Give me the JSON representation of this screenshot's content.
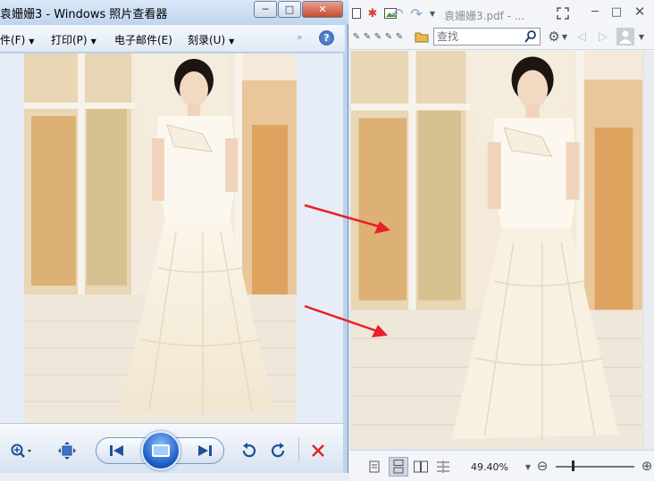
{
  "viewer": {
    "title": "袁姗姗3 - Windows 照片查看器",
    "caption_minimize": "─",
    "caption_maximize": "□",
    "caption_close": "✕",
    "menu": [
      {
        "label": "件(F)"
      },
      {
        "label": "打印(P)"
      },
      {
        "label": "电子邮件(E)"
      },
      {
        "label": "刻录(U)"
      }
    ],
    "menu_more": "»",
    "help": "?",
    "controls": {
      "zoom_icon": "magnifier-icon",
      "fit_icon": "fit-window-icon",
      "prev_icon": "previous-icon",
      "slideshow_icon": "slideshow-icon",
      "next_icon": "next-icon",
      "rotate_ccw_icon": "rotate-left-icon",
      "rotate_cw_icon": "rotate-right-icon",
      "delete_icon": "delete-icon"
    }
  },
  "pdf": {
    "title": "袁姗姗3.pdf - ...",
    "search_placeholder": "查找",
    "zoom_level": "49.40%",
    "zoom_fraction": 0.2,
    "zoom_minus": "⊖",
    "zoom_plus": "⊕"
  },
  "colors": {
    "arrow": "#e8202a",
    "viewer_chrome": "#bcd3ec",
    "accent_blue": "#1e5fc6"
  }
}
